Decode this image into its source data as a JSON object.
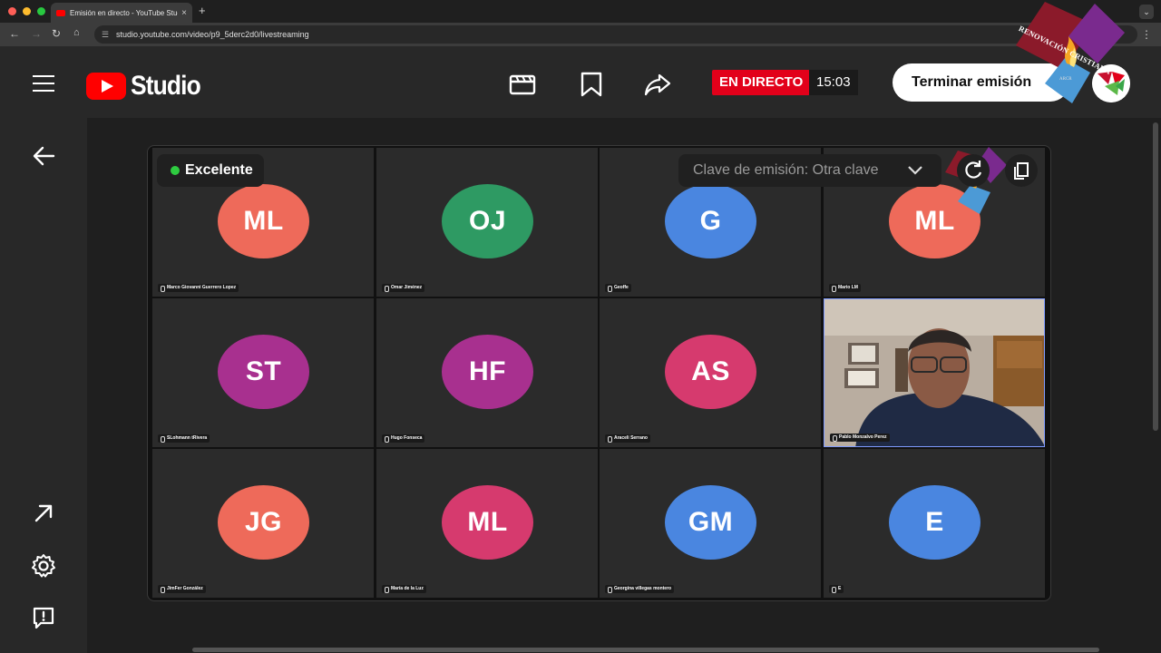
{
  "browser": {
    "tab_title": "Emisión en directo - YouTube Studio",
    "tab_close": "×",
    "new_tab": "+",
    "url": "studio.youtube.com/video/p9_5derc2d0/livestreaming"
  },
  "header": {
    "logo_text": "Studio",
    "live_badge": "EN DIRECTO",
    "timer": "15:03",
    "end_button": "Terminar emisión"
  },
  "watermark": {
    "text": "RENOVACIÓN CRISTIANA"
  },
  "stream": {
    "quality": "Excelente",
    "stream_key": "Clave de emisión: Otra clave",
    "participants": [
      {
        "initials": "ML",
        "name": "Marco Giovanni Guerrero Lopez",
        "color": "#ee6a5a"
      },
      {
        "initials": "OJ",
        "name": "Omar Jiménez",
        "color": "#2e9a63"
      },
      {
        "initials": "G",
        "name": "Geoffe",
        "color": "#4a86e0"
      },
      {
        "initials": "ML",
        "name": "Mario LM",
        "color": "#ee6a5a"
      },
      {
        "initials": "ST",
        "name": "SLohmann tRivera",
        "color": "#a8308f"
      },
      {
        "initials": "HF",
        "name": "Hugo Fonseca",
        "color": "#a8308f"
      },
      {
        "initials": "AS",
        "name": "Araceli Serrano",
        "color": "#d63a6e"
      },
      {
        "initials": "",
        "name": "Pablo Monzalvo Perez",
        "color": ""
      },
      {
        "initials": "JG",
        "name": "JimFer González",
        "color": "#ee6a5a"
      },
      {
        "initials": "ML",
        "name": "María de la Luz",
        "color": "#d63a6e"
      },
      {
        "initials": "GM",
        "name": "Georgina villegas montero",
        "color": "#4a86e0"
      },
      {
        "initials": "E",
        "name": "E",
        "color": "#4a86e0"
      }
    ]
  }
}
